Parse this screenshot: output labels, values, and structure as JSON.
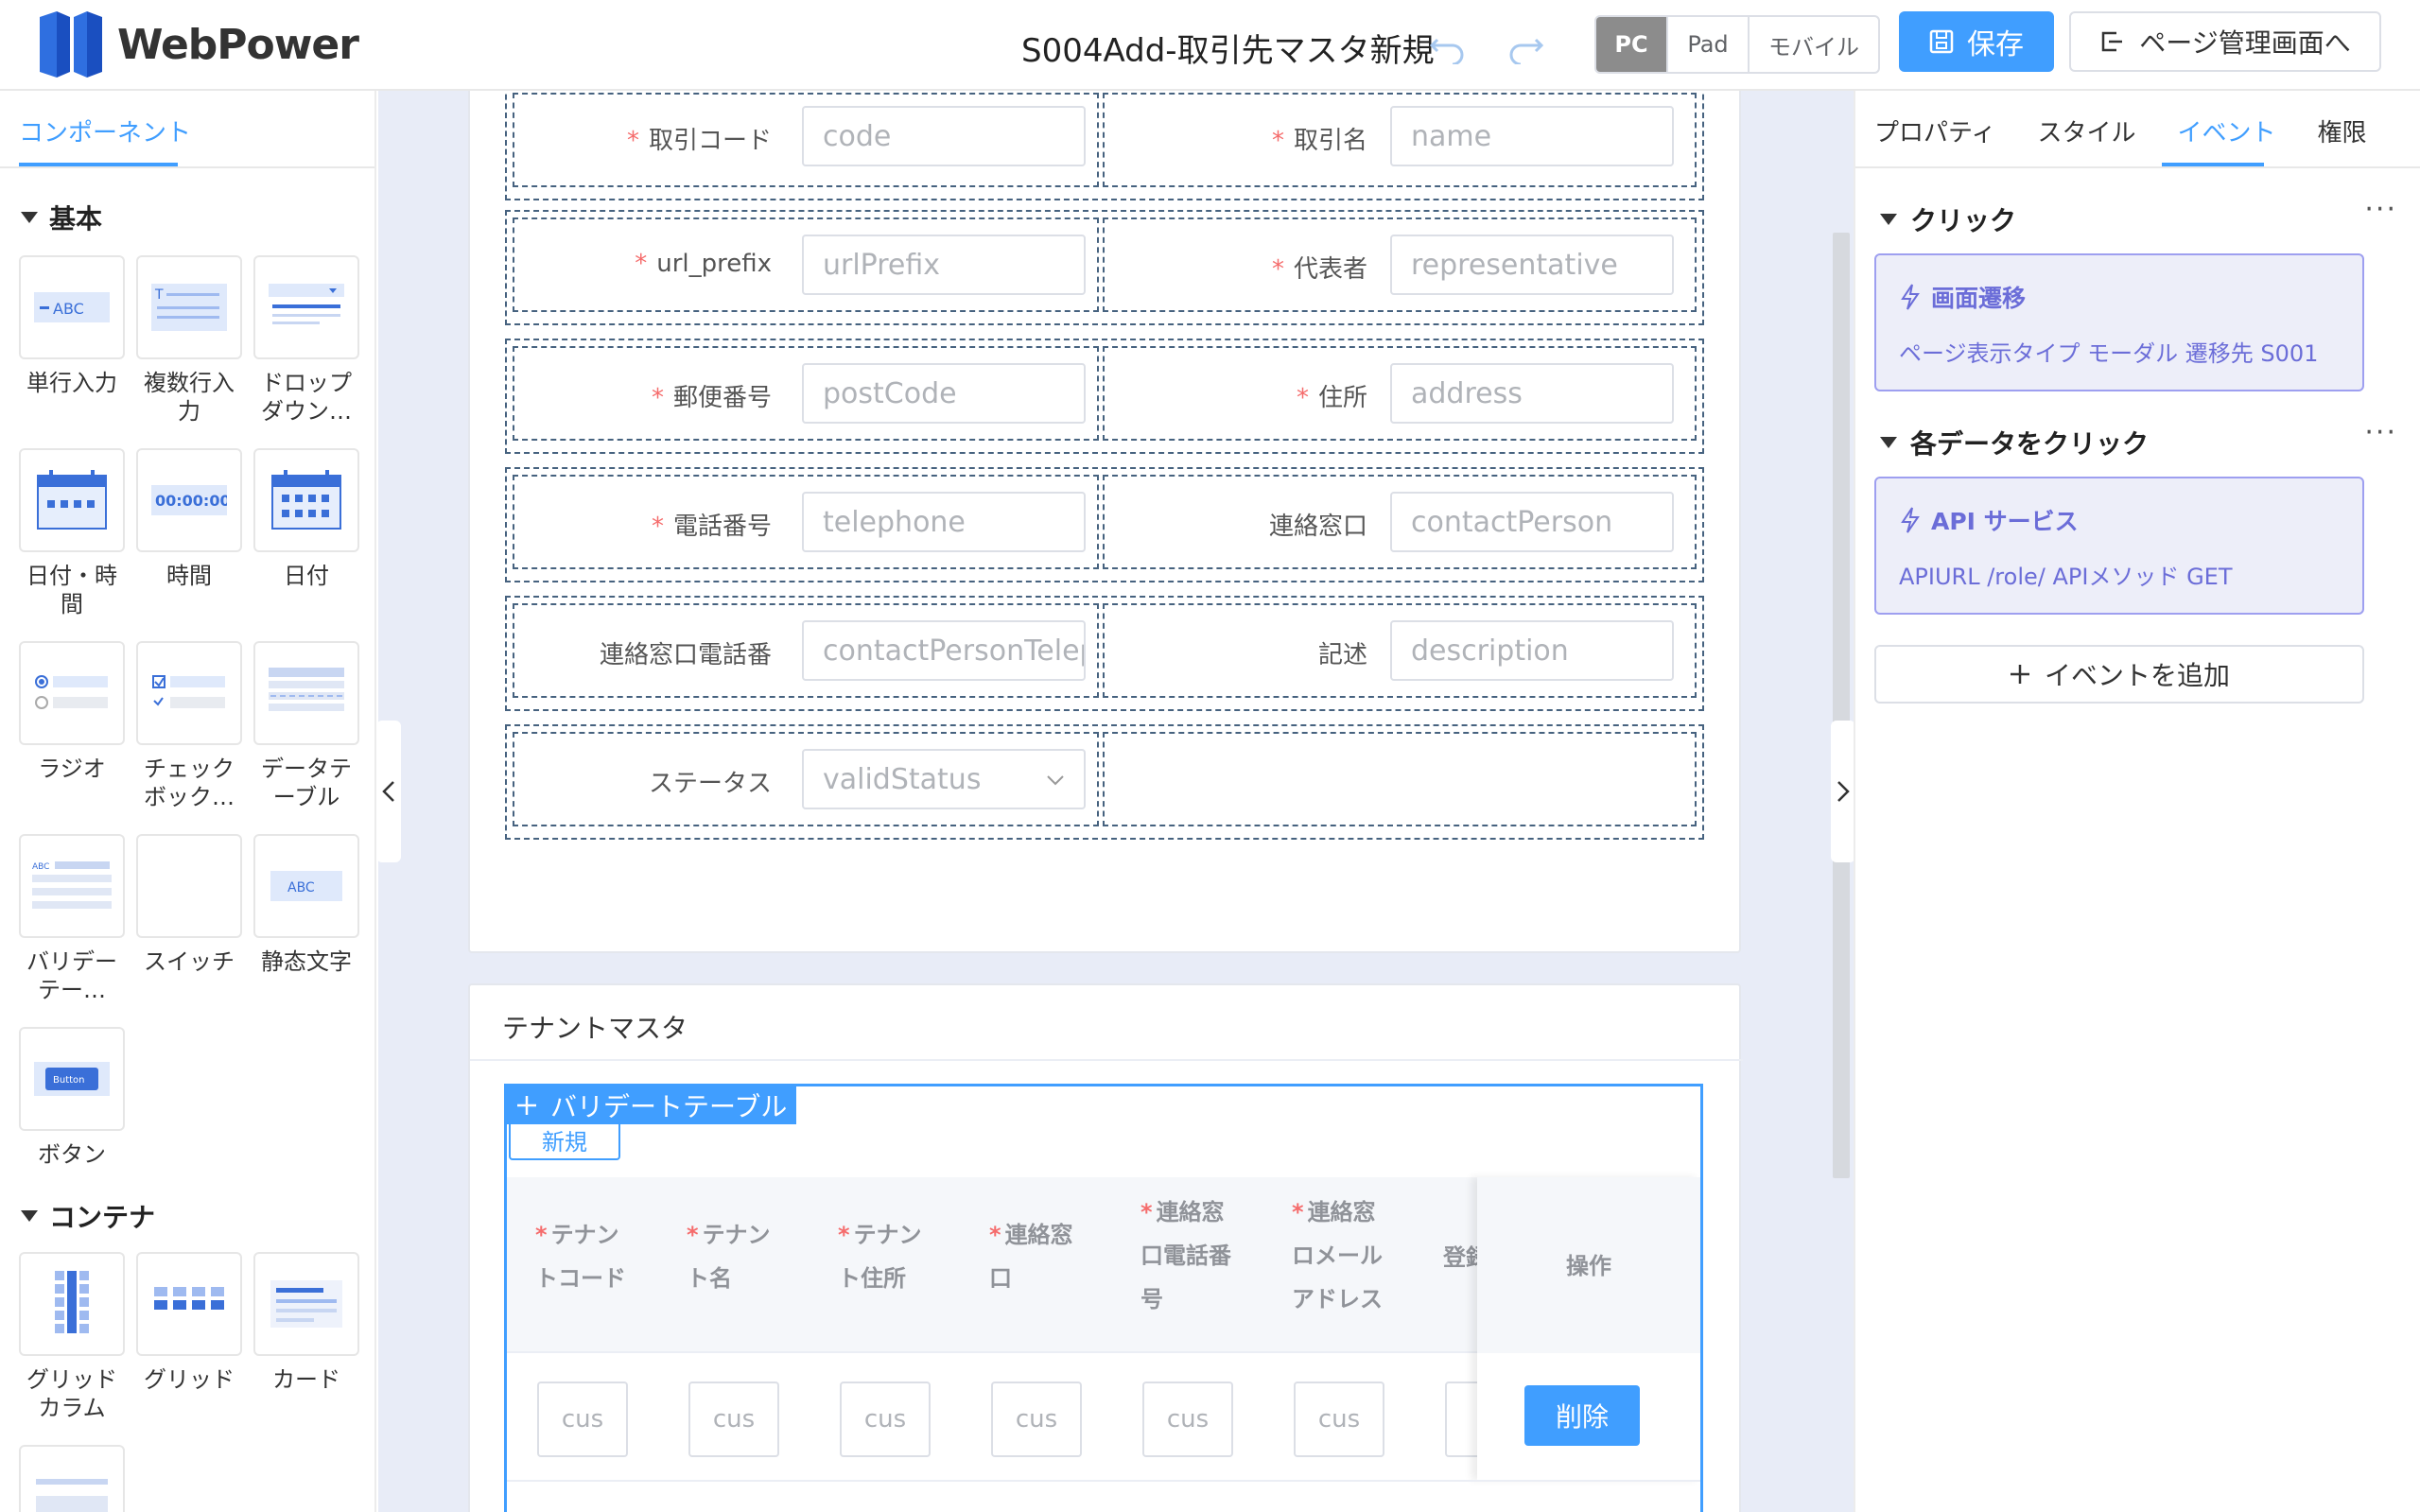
{
  "header": {
    "brand": "WebPower",
    "title": "S004Add-取引先マスタ新規",
    "devices": [
      "PC",
      "Pad",
      "モバイル"
    ],
    "active_device": "PC",
    "save_label": "保存",
    "back_label": "ページ管理画面へ",
    "colors": {
      "accent": "#409eff",
      "active_segment": "#8c8c8c"
    }
  },
  "left_panel": {
    "tab": "コンポーネント",
    "sections": [
      {
        "title": "基本",
        "items": [
          "単行入力",
          "複数行入力",
          "ドロップダウン…",
          "日付・時間",
          "時間",
          "日付",
          "ラジオ",
          "チェックボック…",
          "データテーブル",
          "バリデーテー…",
          "スイッチ",
          "静态文字",
          "ボタン"
        ]
      },
      {
        "title": "コンテナ",
        "items": [
          "グリッドカラム",
          "グリッド",
          "カード"
        ]
      }
    ],
    "thumb_texts": {
      "abc": "ABC",
      "time": "00:00:00",
      "button": "Button"
    }
  },
  "form": {
    "rows": [
      [
        {
          "label": "取引コード",
          "required": true,
          "placeholder": "code"
        },
        {
          "label": "取引名",
          "required": true,
          "placeholder": "name"
        }
      ],
      [
        {
          "label": "url_prefix",
          "required": true,
          "placeholder": "urlPrefix"
        },
        {
          "label": "代表者",
          "required": true,
          "placeholder": "representative"
        }
      ],
      [
        {
          "label": "郵便番号",
          "required": true,
          "placeholder": "postCode"
        },
        {
          "label": "住所",
          "required": true,
          "placeholder": "address"
        }
      ],
      [
        {
          "label": "電話番号",
          "required": true,
          "placeholder": "telephone"
        },
        {
          "label": "連絡窓口",
          "required": false,
          "placeholder": "contactPerson"
        }
      ],
      [
        {
          "label": "連絡窓口電話番",
          "required": false,
          "placeholder": "contactPersonTelep"
        },
        {
          "label": "記述",
          "required": false,
          "placeholder": "description"
        }
      ],
      [
        {
          "label": "ステータス",
          "required": false,
          "placeholder": "validStatus",
          "select": true
        }
      ]
    ]
  },
  "tenant": {
    "title": "テナントマスタ",
    "tag": "バリデートテーブル",
    "new_label": "新規",
    "columns": [
      {
        "lines": [
          "テナン",
          "トコード"
        ],
        "required": true
      },
      {
        "lines": [
          "テナン",
          "ト名"
        ],
        "required": true
      },
      {
        "lines": [
          "テナン",
          "ト住所"
        ],
        "required": true
      },
      {
        "lines": [
          "連絡窓",
          "口"
        ],
        "required": true
      },
      {
        "lines": [
          "連絡窓",
          "口電話番",
          "号"
        ],
        "required": true
      },
      {
        "lines": [
          "連絡窓",
          "ロメール",
          "アドレス"
        ],
        "required": true
      },
      {
        "lines": [
          "登録"
        ],
        "required": false
      }
    ],
    "cell_placeholder": "cus",
    "ops_header": "操作",
    "delete_label": "削除"
  },
  "right_panel": {
    "tabs": [
      "プロパティ",
      "スタイル",
      "イベント",
      "権限"
    ],
    "active_tab": "イベント",
    "events": [
      {
        "section": "クリック",
        "title": "画面遷移",
        "detail": "ページ表示タイプ  モーダル  遷移先  S001"
      },
      {
        "section": "各データをクリック",
        "title": "API サービス",
        "detail": "APIURL  /role/  APIメソッド  GET"
      }
    ],
    "add_label": "イベントを追加",
    "colors": {
      "event_bg": "#edeef9",
      "event_fg": "#6b6dd8"
    }
  }
}
